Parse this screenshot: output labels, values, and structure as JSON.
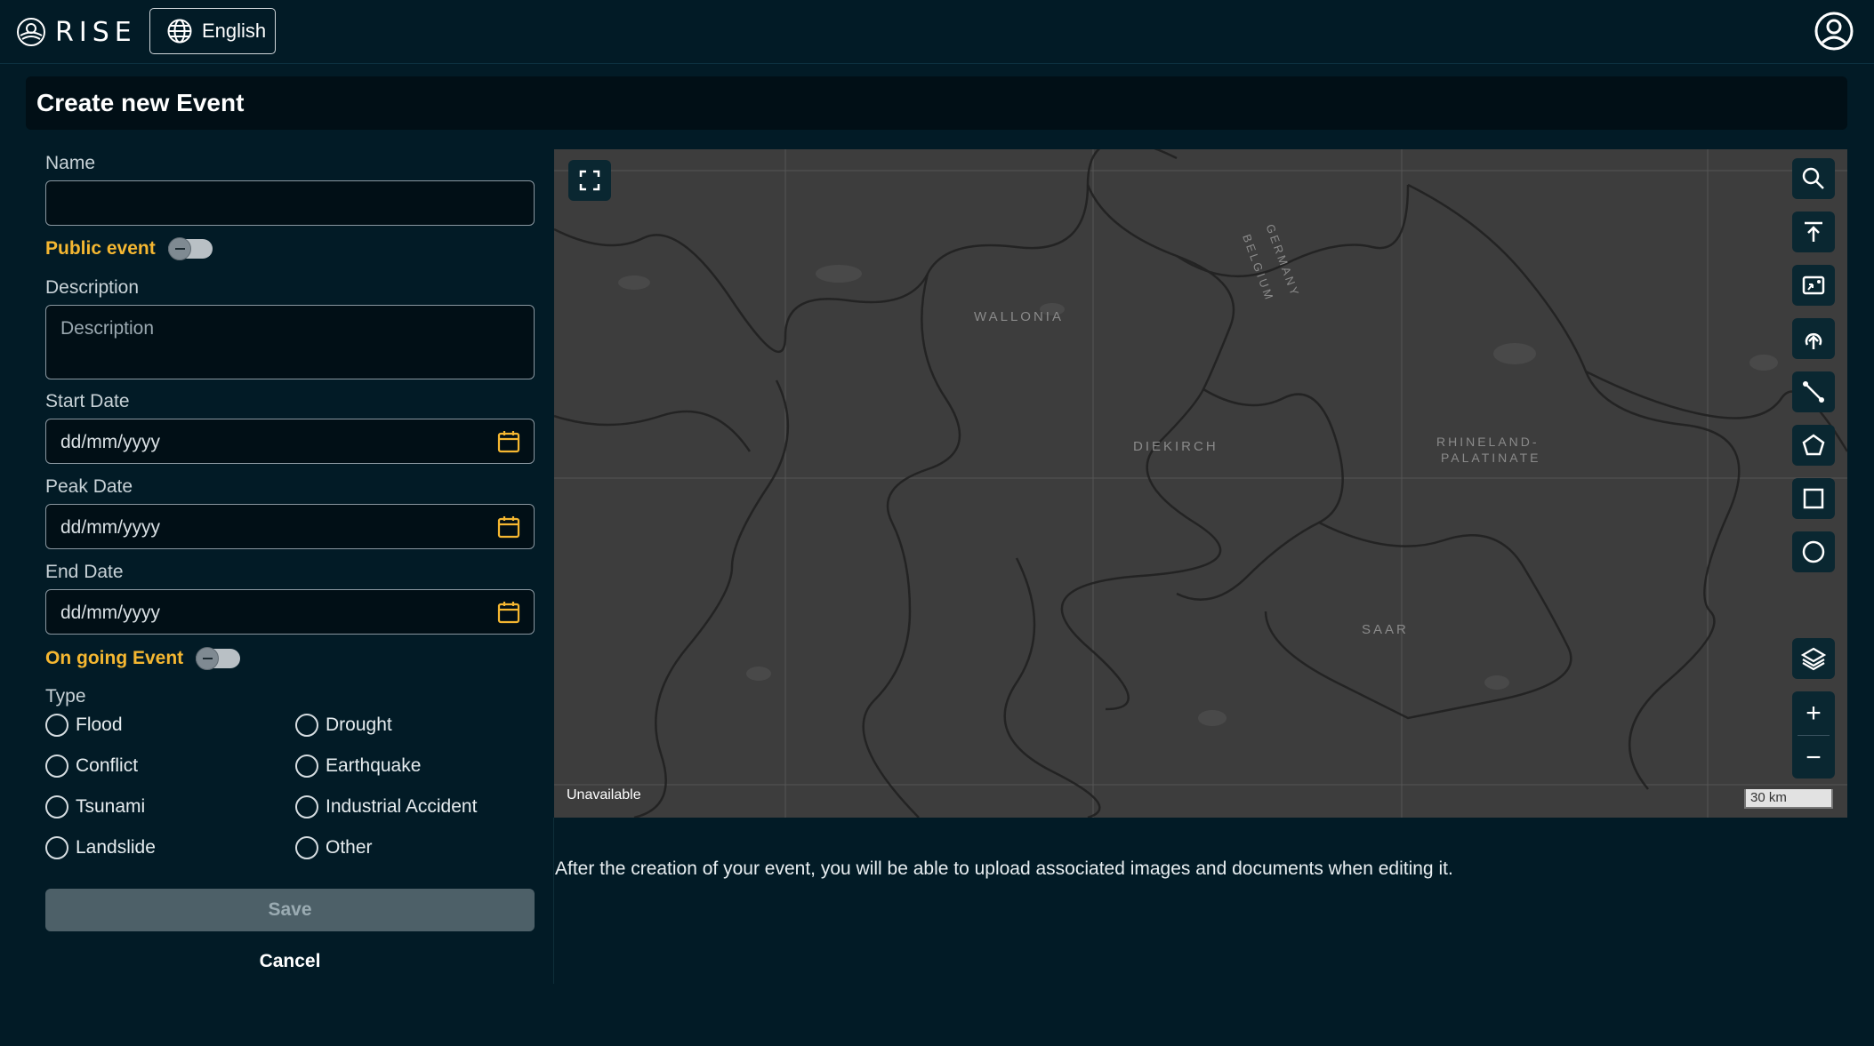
{
  "header": {
    "logo_text": "RISE",
    "language_label": "English"
  },
  "page": {
    "title": "Create new Event"
  },
  "form": {
    "name_label": "Name",
    "name_value": "",
    "public_event_label": "Public event",
    "public_event_on": false,
    "description_label": "Description",
    "description_placeholder": "Description",
    "start_date_label": "Start Date",
    "start_date_placeholder": "dd/mm/yyyy",
    "peak_date_label": "Peak Date",
    "peak_date_placeholder": "dd/mm/yyyy",
    "end_date_label": "End Date",
    "end_date_placeholder": "dd/mm/yyyy",
    "ongoing_label": "On going Event",
    "ongoing_on": false,
    "type_label": "Type",
    "types": [
      "Flood",
      "Drought",
      "Conflict",
      "Earthquake",
      "Tsunami",
      "Industrial Accident",
      "Landslide",
      "Other"
    ],
    "save_label": "Save",
    "cancel_label": "Cancel"
  },
  "map": {
    "attribution": "Unavailable",
    "scale_label": "30 km",
    "region_labels": [
      "WALLONIA",
      "GERMANY",
      "BELGIUM",
      "DIEKIRCH",
      "RHINELAND-",
      "PALATINATE",
      "SAAR"
    ],
    "controls": [
      "search-icon",
      "upload-top-icon",
      "image-export-icon",
      "cloud-upload-icon",
      "draw-line-icon",
      "draw-polygon-icon",
      "draw-rectangle-icon",
      "draw-circle-icon",
      "layers-icon"
    ],
    "zoom_in": "+",
    "zoom_out": "−"
  },
  "note": "After the creation of your event, you will be able to upload associated images and documents when editing it.",
  "colors": {
    "background": "#021b26",
    "accent": "#f5b731",
    "panel": "#010f16",
    "map_bg": "#3d3d3d"
  }
}
